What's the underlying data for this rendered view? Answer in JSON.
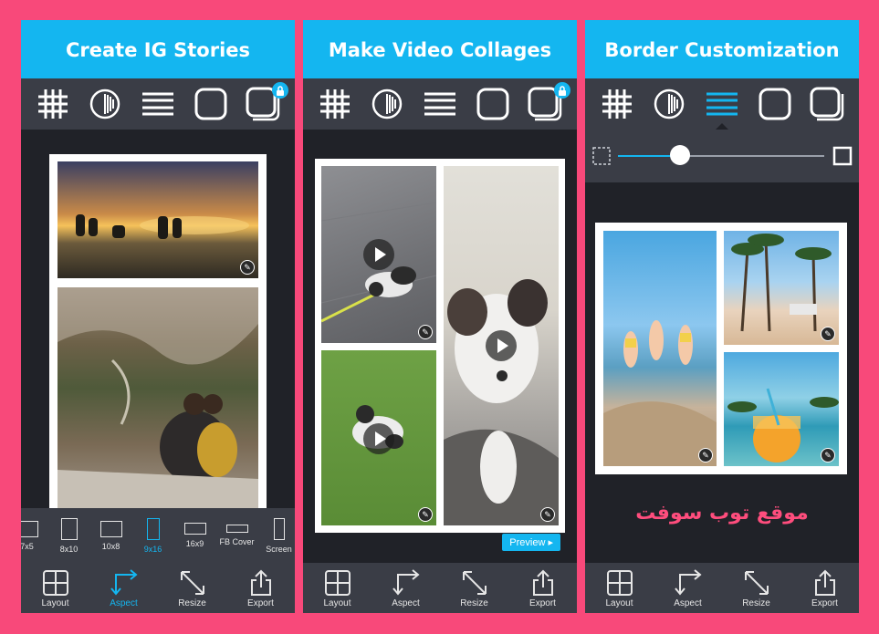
{
  "colors": {
    "accent": "#14b6f0",
    "frame": "#f8497a",
    "toolbar": "#3a3d46",
    "workspace": "#202228",
    "watermark": "#ff4d7d"
  },
  "panels": [
    {
      "title": "Create IG Stories"
    },
    {
      "title": "Make Video Collages",
      "preview_label": "Preview ▸"
    },
    {
      "title": "Border Customization",
      "watermark": "موقع توب سوفت",
      "border_level": 0.3
    }
  ],
  "toolbar_icons": [
    "grid-icon",
    "round-corners-icon",
    "spacing-icon",
    "rounded-square-icon",
    "shadow-square-icon"
  ],
  "aspect_options": [
    {
      "label": "7x5",
      "shape": "landscape"
    },
    {
      "label": "8x10",
      "shape": "portrait"
    },
    {
      "label": "10x8",
      "shape": "landscape"
    },
    {
      "label": "9x16",
      "shape": "tall",
      "active": true
    },
    {
      "label": "16x9",
      "shape": "wide"
    },
    {
      "label": "FB Cover",
      "shape": "banner"
    },
    {
      "label": "Screen",
      "shape": "phone"
    }
  ],
  "bottom_nav": [
    {
      "label": "Layout",
      "icon": "layout-icon"
    },
    {
      "label": "Aspect",
      "icon": "aspect-icon"
    },
    {
      "label": "Resize",
      "icon": "resize-icon"
    },
    {
      "label": "Export",
      "icon": "export-icon"
    }
  ]
}
